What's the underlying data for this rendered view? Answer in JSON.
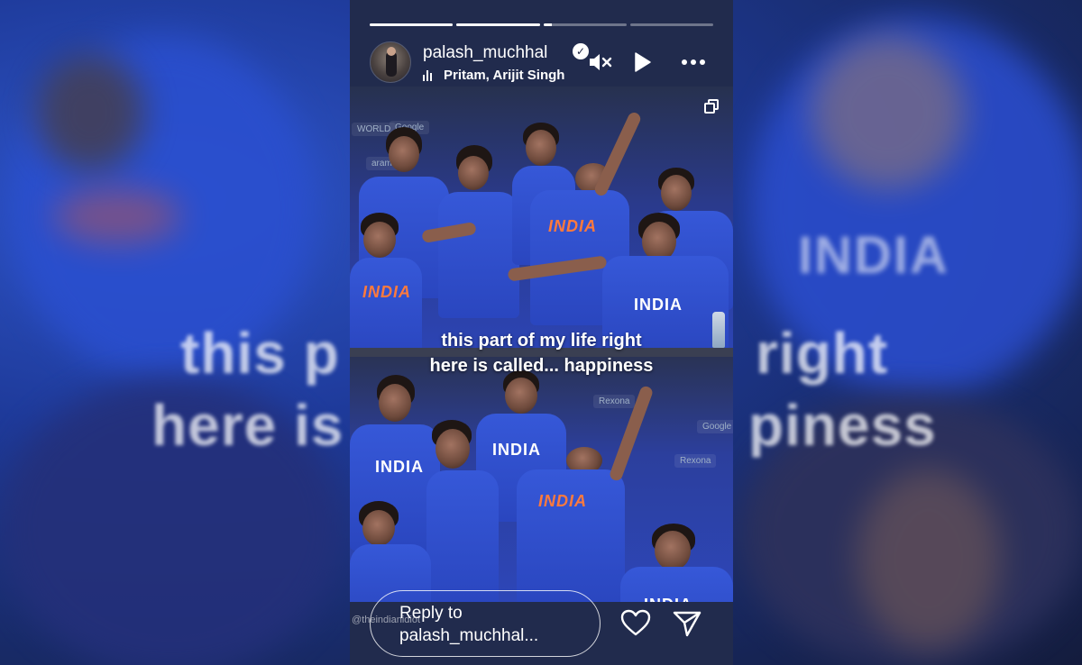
{
  "backdrop": {
    "caption_line1": "this p",
    "caption_line1_right": "right",
    "caption_line2": "here is",
    "caption_line2_right": "piness",
    "jersey_word": "INDIA"
  },
  "story": {
    "progress": [
      1.0,
      1.0,
      0.1,
      0.0
    ],
    "username": "palash_muchhal",
    "verified": true,
    "music": "Pritam, Arijit Singh",
    "caption_line1": "this part of my life right",
    "caption_line2": "here is called... happiness",
    "watermark": "@theindianidiot",
    "reply_line1": "Reply to",
    "reply_line2": "palash_muchhal...",
    "jersey_text": "INDIA",
    "ads": [
      "WORLD",
      "Google",
      "aramco",
      "Rexona",
      "Rexona",
      "Google"
    ]
  },
  "icons": {
    "mute": "mute-icon",
    "play": "play-icon",
    "more": "more-icon",
    "heart": "heart-icon",
    "send": "send-icon",
    "music": "music-bars-icon",
    "multi": "multi-slide-icon"
  },
  "colors": {
    "frame": "#212b4d",
    "jersey": "#2f4fcf",
    "text": "#ffffff"
  }
}
